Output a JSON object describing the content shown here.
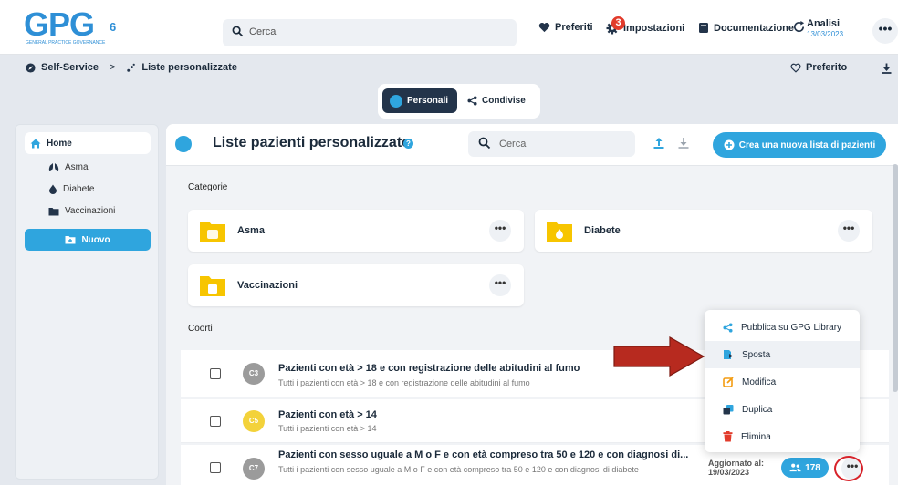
{
  "app": {
    "logo_text": "GPG",
    "logo_subtext": "GENERAL PRACTICE GOVERNANCE",
    "logo_version": "6"
  },
  "topbar": {
    "search_placeholder": "Cerca",
    "nav": {
      "preferiti": "Preferiti",
      "impostazioni": "Impostazioni",
      "impostazioni_badge": "3",
      "documentazione": "Documentazione",
      "analisi": "Analisi",
      "analisi_date": "13/03/2023"
    },
    "more_label": "•••"
  },
  "breadcrumb": {
    "items": [
      "Self-Service",
      "Liste personalizzate"
    ],
    "separator": ">",
    "preferito": "Preferito"
  },
  "tabs": [
    {
      "label": "Personali",
      "active": true
    },
    {
      "label": "Condivise",
      "active": false
    }
  ],
  "sidebar": {
    "home": "Home",
    "items": [
      "Asma",
      "Diabete",
      "Vaccinazioni"
    ],
    "new_button": "Nuovo"
  },
  "main": {
    "title": "Liste pazienti personalizzate",
    "help": "?",
    "search_placeholder": "Cerca",
    "new_list_button": "Crea una nuova lista di pazienti",
    "categories_label": "Categorie",
    "categories": [
      "Asma",
      "Diabete",
      "Vaccinazioni"
    ],
    "cohorts_label": "Coorti",
    "dots": "•••",
    "rows": [
      {
        "badge": "C3",
        "badge_color": "#9b9b9b",
        "title": "Pazienti con età > 18 e con registrazione delle abitudini al fumo",
        "subtitle": "Tutti i pazienti con età > 18 e con registrazione delle abitudini al fumo"
      },
      {
        "badge": "C5",
        "badge_color": "#f3d23a",
        "title": "Pazienti con età > 14",
        "subtitle": "Tutti i pazienti con età > 14"
      },
      {
        "badge": "C7",
        "badge_color": "#9b9b9b",
        "title": "Pazienti con sesso uguale a M o F e con età compreso tra 50 e 120 e con diagnosi di...",
        "subtitle": "Tutti i pazienti con sesso uguale a M o F e con età compreso tra 50 e 120 e con diagnosi di diabete",
        "updated_label": "Aggiornato al:",
        "updated_date": "19/03/2023",
        "count": "178"
      }
    ]
  },
  "context_menu": {
    "items": [
      {
        "label": "Pubblica su GPG Library",
        "icon": "share-icon",
        "color": "#2fa5de"
      },
      {
        "label": "Sposta",
        "icon": "move-icon",
        "color": "#2fa5de"
      },
      {
        "label": "Modifica",
        "icon": "edit-icon",
        "color": "#f39c12"
      },
      {
        "label": "Duplica",
        "icon": "duplicate-icon",
        "color": "#2fa5de"
      },
      {
        "label": "Elimina",
        "icon": "trash-icon",
        "color": "#e23b2b"
      }
    ],
    "highlighted": "Sposta"
  },
  "colors": {
    "accent": "#2fa5de",
    "dark": "#23344a",
    "folder": "#f7c500",
    "annotation": "#d8232a"
  }
}
